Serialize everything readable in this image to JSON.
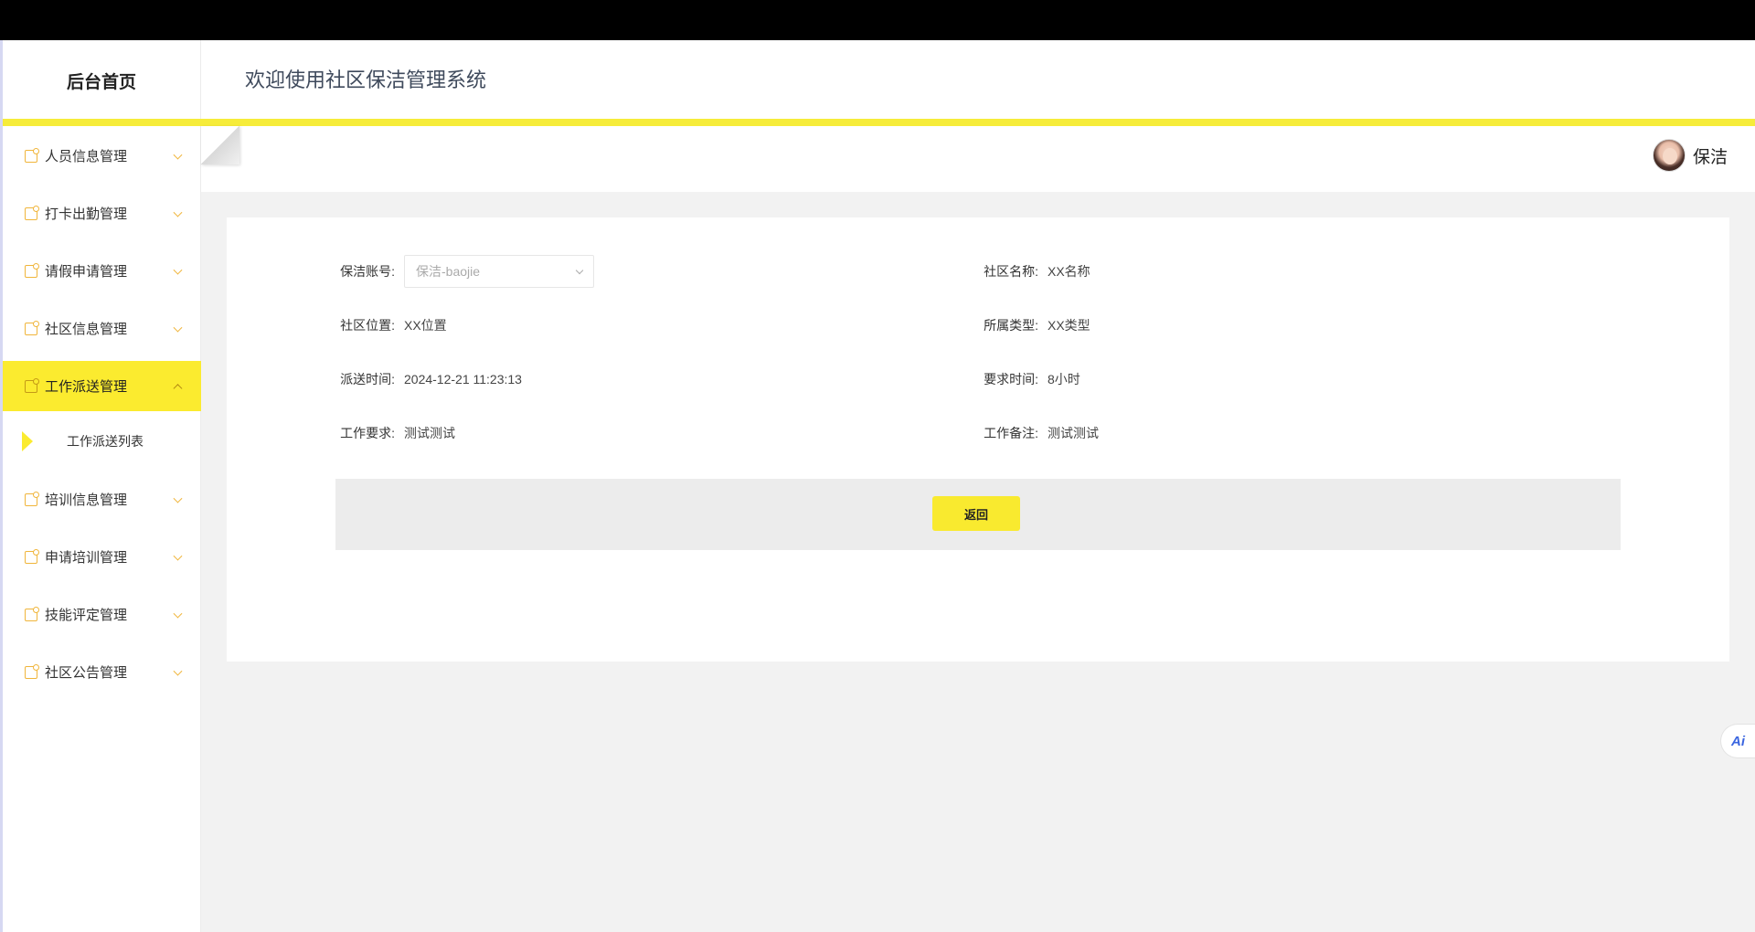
{
  "sidebar": {
    "brand": "后台首页",
    "items": [
      {
        "label": "人员信息管理"
      },
      {
        "label": "打卡出勤管理"
      },
      {
        "label": "请假申请管理"
      },
      {
        "label": "社区信息管理"
      },
      {
        "label": "工作派送管理",
        "active": true
      },
      {
        "label": "培训信息管理"
      },
      {
        "label": "申请培训管理"
      },
      {
        "label": "技能评定管理"
      },
      {
        "label": "社区公告管理"
      }
    ],
    "sub_items": [
      {
        "label": "工作派送列表"
      }
    ]
  },
  "header": {
    "title": "欢迎使用社区保洁管理系统"
  },
  "user": {
    "name": "保洁"
  },
  "form": {
    "account": {
      "label": "保洁账号:",
      "value": "保洁-baojie"
    },
    "community_name": {
      "label": "社区名称:",
      "value": "XX名称"
    },
    "community_location": {
      "label": "社区位置:",
      "value": "XX位置"
    },
    "type": {
      "label": "所属类型:",
      "value": "XX类型"
    },
    "dispatch_time": {
      "label": "派送时间:",
      "value": "2024-12-21 11:23:13"
    },
    "required_time": {
      "label": "要求时间:",
      "value": "8小时"
    },
    "work_requirement": {
      "label": "工作要求:",
      "value": "测试测试"
    },
    "work_note": {
      "label": "工作备注:",
      "value": "测试测试"
    }
  },
  "actions": {
    "back_label": "返回"
  },
  "ai_button": {
    "label": "Ai"
  },
  "colors": {
    "accent": "#fbeb2f",
    "header_bar": "#f6ec3a",
    "icon_orange": "#f0b53b"
  }
}
